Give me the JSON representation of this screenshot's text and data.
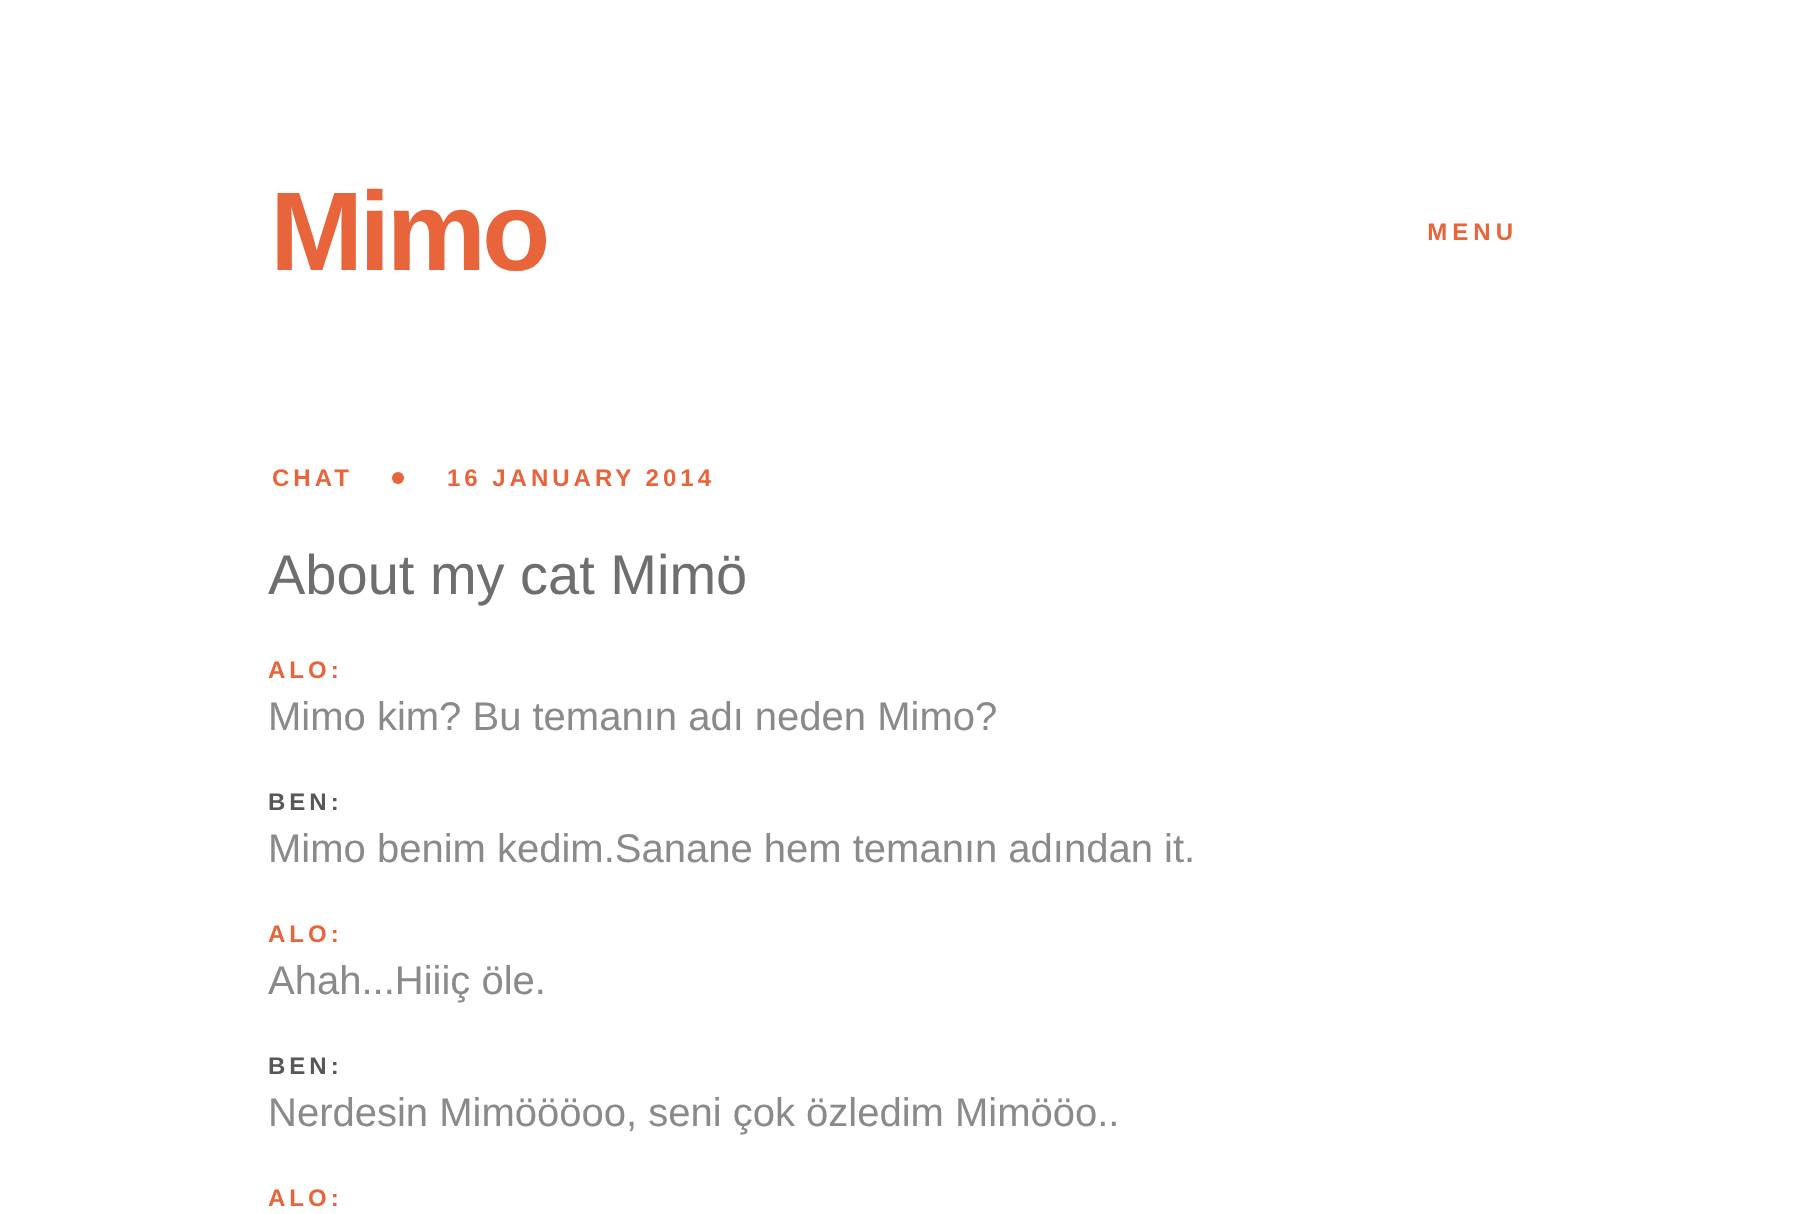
{
  "header": {
    "logo": "Mimo",
    "menu": "MENU"
  },
  "post": {
    "category": "CHAT",
    "date": "16 JANUARY 2014",
    "title": "About my cat Mimö",
    "messages": [
      {
        "speaker": "ALO:",
        "color": "#e8643a",
        "text": "Mimo kim? Bu temanın adı neden Mimo?"
      },
      {
        "speaker": "BEN:",
        "color": "#58585a",
        "text": "Mimo benim kedim.Sanane hem temanın adından it."
      },
      {
        "speaker": "ALO:",
        "color": "#e8643a",
        "text": "Ahah...Hiiiç öle."
      },
      {
        "speaker": "BEN:",
        "color": "#58585a",
        "text": "Nerdesin Mimöööoo, seni çok özledim Mimööo.."
      },
      {
        "speaker": "ALO:",
        "color": "#e8643a"
      }
    ]
  }
}
